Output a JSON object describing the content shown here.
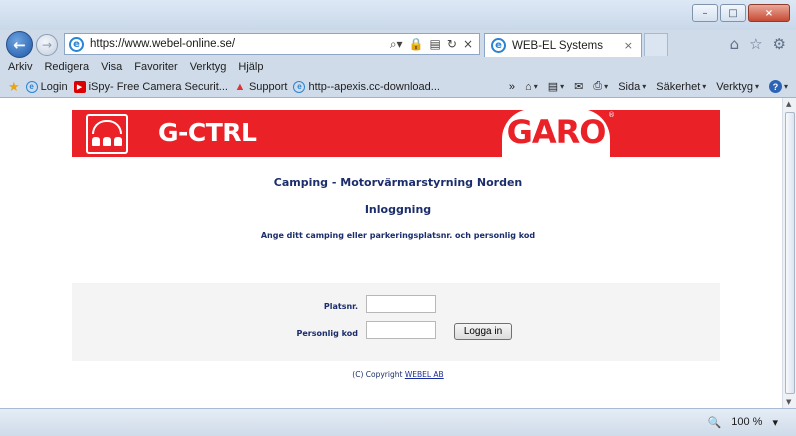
{
  "window": {
    "minimize": "–",
    "maximize": "□",
    "close": "×"
  },
  "address": {
    "url": "https://www.webel-online.se/",
    "tools": [
      "⌕ ▾",
      "🔒",
      "☒",
      "↻",
      "×"
    ]
  },
  "tab": {
    "label": "WEB-EL Systems",
    "close": "×"
  },
  "menubar": [
    "Arkiv",
    "Redigera",
    "Visa",
    "Favoriter",
    "Verktyg",
    "Hjälp"
  ],
  "favorites": [
    {
      "icon": "ie-icon",
      "label": "Login"
    },
    {
      "icon": "youtube-icon",
      "label": "iSpy- Free Camera Securit..."
    },
    {
      "icon": "support-icon",
      "label": "Support"
    },
    {
      "icon": "ie-icon",
      "label": "http--apexis.cc-download..."
    }
  ],
  "commandbar": {
    "page": "Sida",
    "safety": "Säkerhet",
    "tools": "Verktyg",
    "chevron": "»"
  },
  "brand": {
    "product": "G-CTRL",
    "company": "GARO",
    "registered": "®",
    "accent": "#ea2127"
  },
  "page": {
    "heading": "Camping - Motorvärmarstyrning Norden",
    "subheading": "Inloggning",
    "instruction": "Ange ditt camping eller parkeringsplatsnr. och personlig kod"
  },
  "form": {
    "site_label": "Platsnr.",
    "site_value": "",
    "code_label": "Personlig kod",
    "code_value": "",
    "submit": "Logga in"
  },
  "footer": {
    "copyright": "(C) Copyright ",
    "link": "WEBEL AB"
  },
  "status": {
    "zoom": "100 %",
    "zoom_icon": "🔍",
    "caret": "▾"
  }
}
